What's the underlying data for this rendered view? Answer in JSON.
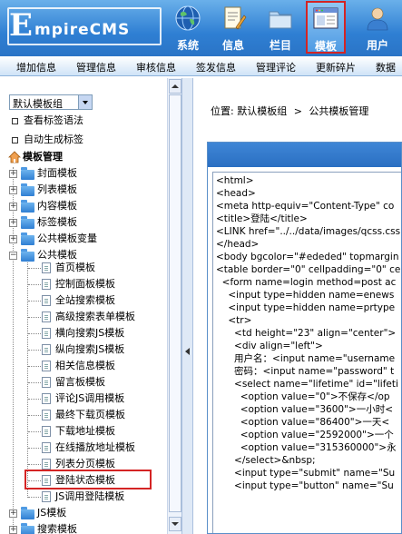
{
  "header": {
    "logo_initial": "E",
    "logo_text": "mpireCMS",
    "nav": [
      {
        "label": "系统",
        "icon": "globe-icon"
      },
      {
        "label": "信息",
        "icon": "document-edit-icon"
      },
      {
        "label": "栏目",
        "icon": "folder-icon"
      },
      {
        "label": "模板",
        "icon": "template-window-icon",
        "active": true
      },
      {
        "label": "用户",
        "icon": "user-icon"
      }
    ]
  },
  "menubar": [
    "增加信息",
    "管理信息",
    "审核信息",
    "签发信息",
    "管理评论",
    "更新碎片",
    "数据"
  ],
  "sidebar": {
    "template_group": "默认模板组",
    "links": [
      "查看标签语法",
      "自动生成标签"
    ],
    "section_title": "模板管理",
    "folders_top": [
      "封面模板",
      "列表模板",
      "内容模板",
      "标签模板",
      "公共模板变量"
    ],
    "open_folder": "公共模板",
    "children": [
      "首页模板",
      "控制面板模板",
      "全站搜索模板",
      "高级搜索表单模板",
      "横向搜索JS模板",
      "纵向搜索JS模板",
      "相关信息模板",
      "留言板模板",
      "评论JS调用模板",
      "最终下载页模板",
      "下载地址模板",
      "在线播放地址模板",
      "列表分页模板",
      "登陆状态模板",
      "JS调用登陆模板"
    ],
    "selected_child": "登陆状态模板",
    "folders_bottom": [
      "JS模板",
      "搜索模板"
    ]
  },
  "breadcrumb": {
    "prefix": "位置:",
    "group": "默认模板组",
    "sep": ">",
    "page": "公共模板管理"
  },
  "code_lines": [
    "<html>",
    "<head>",
    "<meta http-equiv=\"Content-Type\" co",
    "<title>登陆</title>",
    "<LINK href=\"../../data/images/qcss.css",
    "</head>",
    "<body bgcolor=\"#ededed\" topmargin",
    "<table border=\"0\" cellpadding=\"0\" ce",
    "  <form name=login method=post ac",
    "    <input type=hidden name=enews",
    "    <input type=hidden name=prtype",
    "    <tr>",
    "      <td height=\"23\" align=\"center\">",
    "      <div align=\"left\">",
    "      用户名：<input name=\"username",
    "      密码：<input name=\"password\" t",
    "      <select name=\"lifetime\" id=\"lifeti",
    "        <option value=\"0\">不保存</op",
    "        <option value=\"3600\">一小时<",
    "        <option value=\"86400\">一天<",
    "        <option value=\"2592000\">一个",
    "        <option value=\"315360000\">永",
    "      </select>&nbsp;",
    "      <input type=\"submit\" name=\"Su",
    "      <input type=\"button\" name=\"Su"
  ],
  "colors": {
    "header_blue": "#2f7fd3",
    "highlight_red": "#d42424"
  }
}
